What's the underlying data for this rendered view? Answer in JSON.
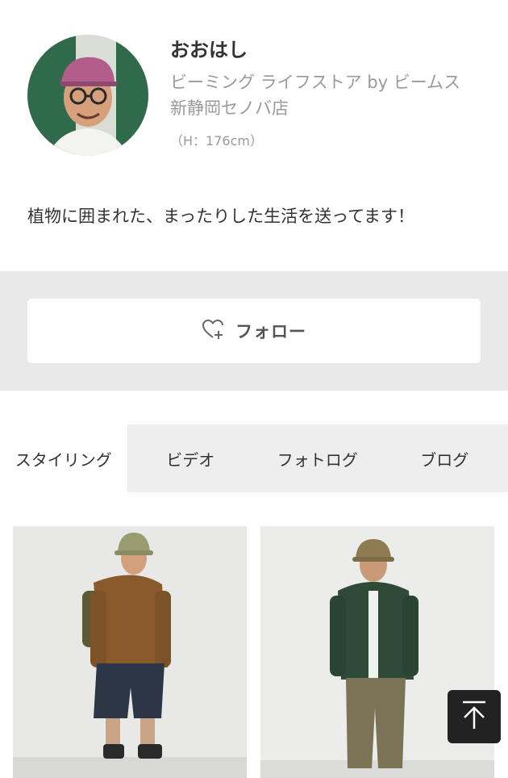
{
  "profile": {
    "name": "おおはし",
    "shop": "ビーミング ライフストア by ビームス 新静岡セノバ店",
    "height": "（H：176cm）",
    "bio": "植物に囲まれた、まったりした生活を送ってます！",
    "avatar_alt": "profile-photo"
  },
  "follow": {
    "label": "フォロー",
    "icon": "heart-plus-icon"
  },
  "tabs": [
    {
      "label": "スタイリング",
      "active": true
    },
    {
      "label": "ビデオ",
      "active": false
    },
    {
      "label": "フォトログ",
      "active": false
    },
    {
      "label": "ブログ",
      "active": false
    }
  ],
  "colors": {
    "band": "#e9e9e9",
    "muted_text": "#9a9a9a",
    "top_button": "#222222"
  },
  "back_to_top_icon": "arrow-up-icon"
}
